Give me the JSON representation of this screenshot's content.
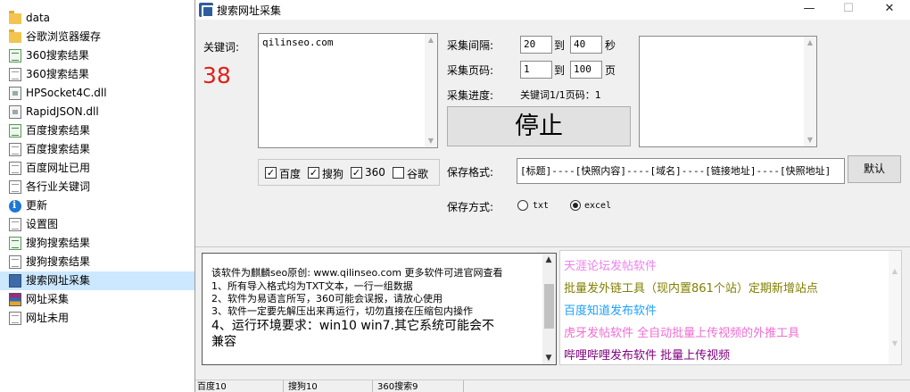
{
  "files": [
    {
      "label": "data",
      "icon": "folder-icon"
    },
    {
      "label": "谷歌浏览器缓存",
      "icon": "folder-icon"
    },
    {
      "label": "360搜索结果",
      "icon": "note-icon"
    },
    {
      "label": "360搜索结果",
      "icon": "document-icon"
    },
    {
      "label": "HPSocket4C.dll",
      "icon": "dll-icon"
    },
    {
      "label": "RapidJSON.dll",
      "icon": "dll-icon"
    },
    {
      "label": "百度搜索结果",
      "icon": "note-icon"
    },
    {
      "label": "百度搜索结果",
      "icon": "document-icon"
    },
    {
      "label": "百度网址已用",
      "icon": "document-icon"
    },
    {
      "label": "各行业关键词",
      "icon": "document-icon"
    },
    {
      "label": "更新",
      "icon": "info-icon"
    },
    {
      "label": "设置图",
      "icon": "document-icon"
    },
    {
      "label": "搜狗搜索结果",
      "icon": "note-icon"
    },
    {
      "label": "搜狗搜索结果",
      "icon": "document-icon"
    },
    {
      "label": "搜索网址采集",
      "icon": "app-icon"
    },
    {
      "label": "网址采集",
      "icon": "archive-icon"
    },
    {
      "label": "网址未用",
      "icon": "document-icon"
    }
  ],
  "window": {
    "title": "搜索网址采集",
    "minimize": "—",
    "maximize": "☐",
    "close": "✕"
  },
  "form": {
    "keyword_label": "关键词:",
    "count": "38",
    "keywords": "qilinseo.com",
    "engines": [
      {
        "label": "百度",
        "checked": true
      },
      {
        "label": "搜狗",
        "checked": true
      },
      {
        "label": "360",
        "checked": true
      },
      {
        "label": "谷歌",
        "checked": false
      }
    ],
    "interval_label": "采集间隔:",
    "interval_from": "20",
    "interval_to": "40",
    "to_label": "到",
    "interval_unit": "秒",
    "pages_label": "采集页码:",
    "page_from": "1",
    "page_to": "100",
    "page_unit": "页",
    "progress_label": "采集进度:",
    "progress_text": "关键词1/1页码：1",
    "stop_label": "停止",
    "format_label": "保存格式:",
    "format_value": "[标题]----[快照内容]----[域名]----[链接地址]----[快照地址]",
    "default_label": "默认",
    "method_label": "保存方式:",
    "method_options": [
      {
        "label": "txt",
        "selected": false
      },
      {
        "label": "excel",
        "selected": true
      }
    ]
  },
  "info": {
    "lines": [
      "该软件为麒麟seo原创: www.qilinseo.com 更多软件可进官网查看",
      "1、所有导入格式均为TXT文本，一行一组数据",
      "2、软件为易语言所写，360可能会误报，请放心使用",
      "3、软件一定要先解压出来再运行，切勿直接在压缩包内操作",
      "4、运行环境要求：win10 win7.其它系统可能会不",
      "兼容"
    ]
  },
  "ads": [
    {
      "label": "天涯论坛发帖软件",
      "color": "#ee82ee"
    },
    {
      "label": "批量发外链工具（现内置861个站）定期新增站点",
      "color": "#808000"
    },
    {
      "label": "百度知道发布软件",
      "color": "#1ea0ff"
    },
    {
      "label": "虎牙发帖软件 全自动批量上传视频的外推工具",
      "color": "#f06ed2"
    },
    {
      "label": "哔哩哔哩发布软件 批量上传视频",
      "color": "#800080"
    }
  ],
  "status": {
    "baidu": "百度10",
    "sogou": "搜狗10",
    "so360": "360搜索9"
  }
}
